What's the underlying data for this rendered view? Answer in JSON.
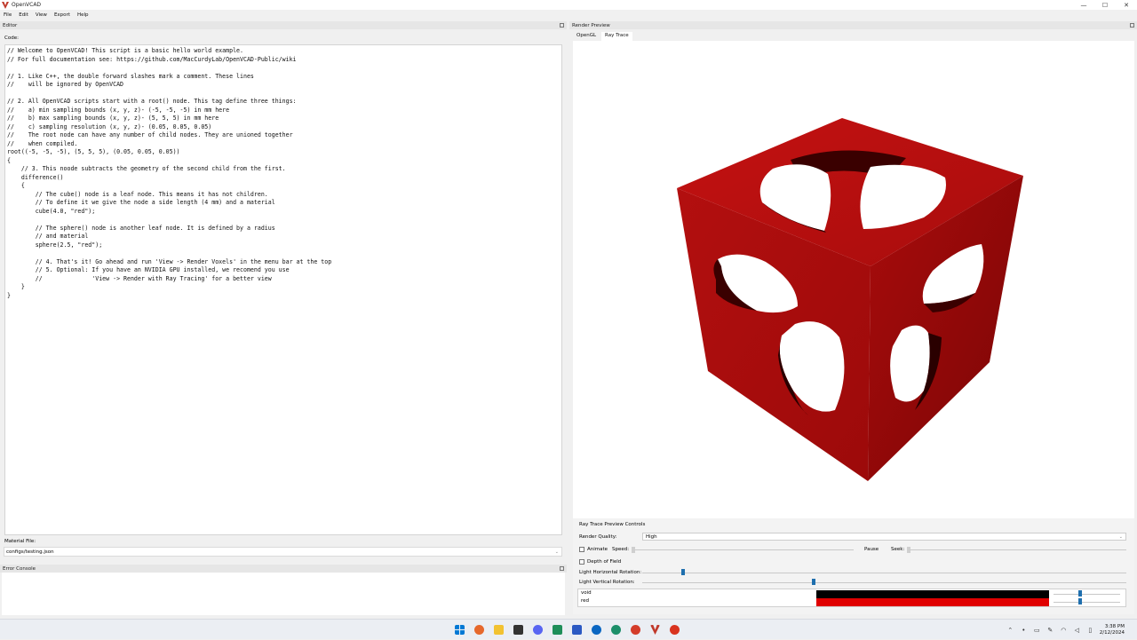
{
  "window": {
    "title": "OpenVCAD",
    "minimize_glyph": "—",
    "maximize_glyph": "☐",
    "close_glyph": "✕"
  },
  "menu": [
    "File",
    "Edit",
    "View",
    "Export",
    "Help"
  ],
  "editor": {
    "panel_title": "Editor",
    "code_label": "Code:",
    "code": "// Welcome to OpenVCAD! This script is a basic hello world example.\n// For full documentation see: https://github.com/MacCurdyLab/OpenVCAD-Public/wiki\n\n// 1. Like C++, the double forward slashes mark a comment. These lines\n//    will be ignored by OpenVCAD\n\n// 2. All OpenVCAD scripts start with a root() node. This tag define three things:\n//    a) min sampling bounds (x, y, z)- (-5, -5, -5) in mm here\n//    b) max sampling bounds (x, y, z)- (5, 5, 5) in mm here\n//    c) sampling resolution (x, y, z)- (0.05, 0.05, 0.05)\n//    The root node can have any number of child nodes. They are unioned together\n//    when compiled.\nroot((-5, -5, -5), (5, 5, 5), (0.05, 0.05, 0.05))\n{\n    // 3. This noode subtracts the geometry of the second child from the first.\n    difference()\n    {\n        // The cube() node is a leaf node. This means it has not children.\n        // To define it we give the node a side length (4 mm) and a material\n        cube(4.0, \"red\");\n\n        // The sphere() node is another leaf node. It is defined by a radius\n        // and material\n        sphere(2.5, \"red\");\n\n        // 4. That's it! Go ahead and run 'View -> Render Voxels' in the menu bar at the top\n        // 5. Optional: If you have an NVIDIA GPU installed, we recomend you use\n        //              'View -> Render with Ray Tracing' for a better view\n    }\n}",
    "material_label": "Material File:",
    "material_value": "configs/testing.json",
    "console_title": "Error Console"
  },
  "preview": {
    "panel_title": "Render Preview",
    "tabs": [
      "OpenGL",
      "Ray Trace"
    ],
    "active_tab": "Ray Trace",
    "controls_title": "Ray Trace Preview Controls",
    "render_quality_label": "Render Quality:",
    "render_quality_value": "High",
    "animate_label": "Animate",
    "animate_checked": false,
    "speed_label": "Speed:",
    "pause_label": "Pause",
    "seek_label": "Seek:",
    "depth_of_field_label": "Depth of Field",
    "depth_of_field_checked": false,
    "light_h_label": "Light Horizontal Rotation:",
    "light_h_value": 0.08,
    "light_v_label": "Light Vertical Rotation:",
    "light_v_value": 0.35,
    "materials": [
      {
        "name": "void",
        "color": "#000000",
        "opacity": 0.55
      },
      {
        "name": "red",
        "color": "#e00000",
        "opacity": 0.55
      }
    ],
    "cube_color": "#b20d0d"
  },
  "taskbar": {
    "time": "3:38 PM",
    "date": "2/12/2024"
  }
}
